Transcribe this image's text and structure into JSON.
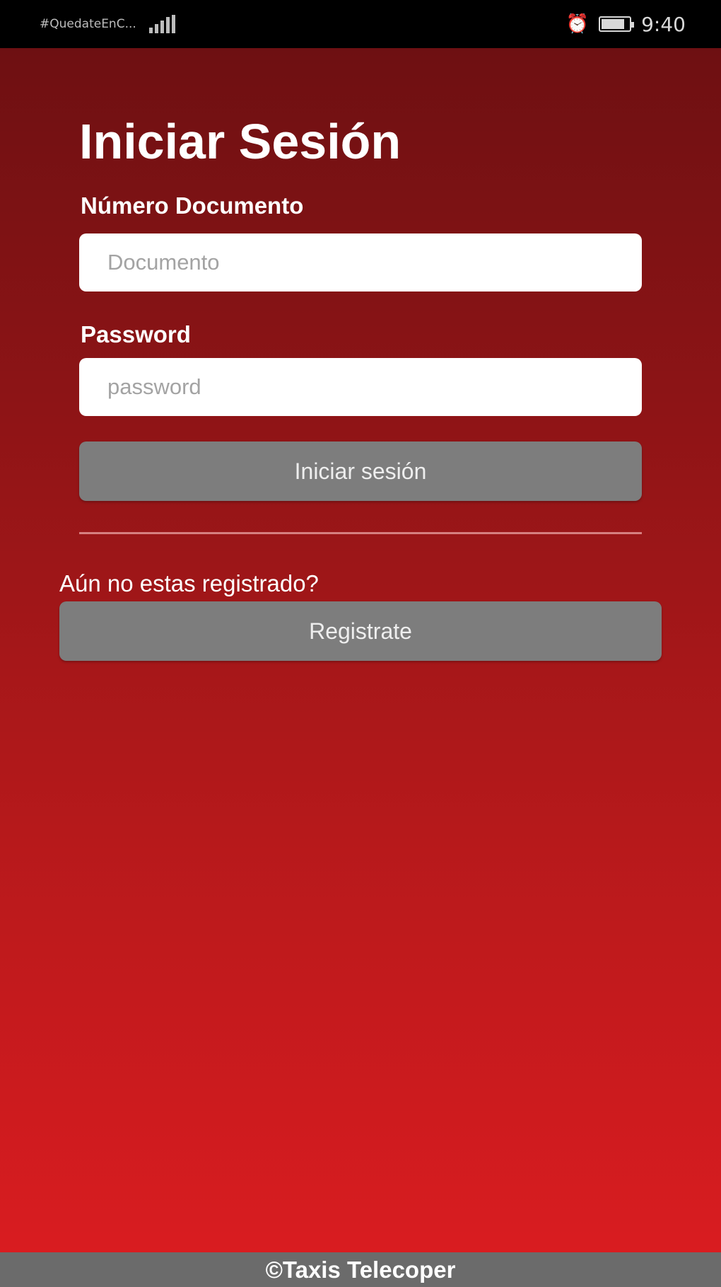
{
  "status_bar": {
    "carrier": "#QuedateEnC...",
    "time": "9:40",
    "battery_level": 0.85,
    "icons": [
      "signal-icon",
      "alarm-icon",
      "battery-icon"
    ]
  },
  "login": {
    "title": "Iniciar Sesión",
    "document_label": "Número Documento",
    "document_placeholder": "Documento",
    "password_label": "Password",
    "password_placeholder": "password",
    "submit_label": "Iniciar sesión"
  },
  "register": {
    "prompt": "Aún no estas registrado?",
    "button_label": "Registrate"
  },
  "footer": {
    "text": "©Taxis Telecoper"
  },
  "colors": {
    "gradient_top": "#6e1012",
    "gradient_bottom": "#d91c20",
    "button_gray": "#7d7d7d",
    "footer_gray": "#6b6b6b"
  }
}
